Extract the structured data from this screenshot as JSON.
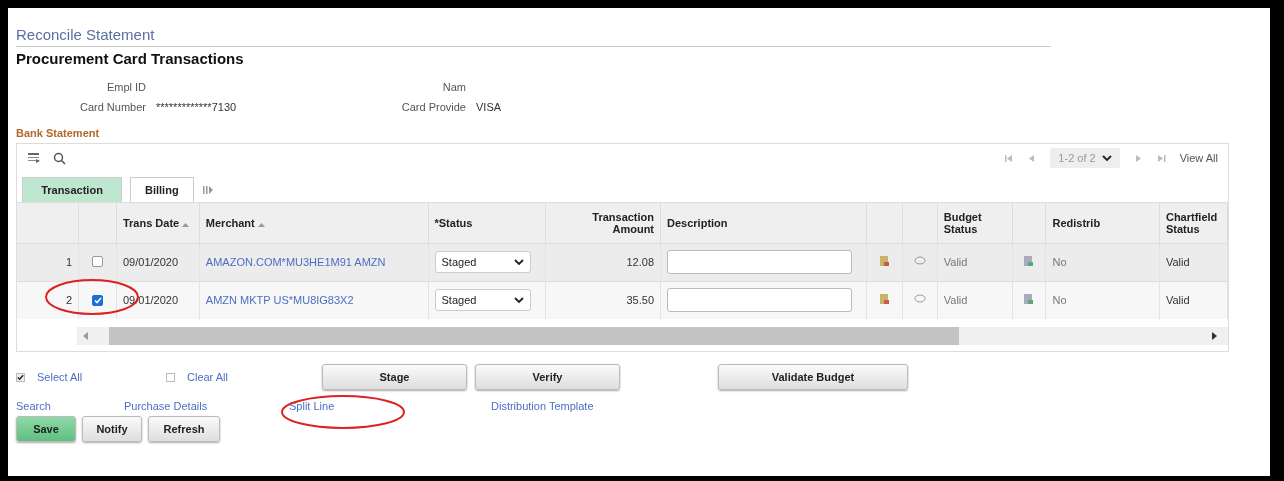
{
  "page_title": "Reconcile Statement",
  "heading": "Procurement Card Transactions",
  "fields": [
    {
      "label": "Empl ID"
    },
    {
      "label": "Nam"
    },
    {
      "label": "Card Number",
      "value": "*************7130"
    },
    {
      "label": "Card Provide",
      "value": "VISA"
    }
  ],
  "section_title": "Bank Statement",
  "pager": {
    "range": "1-2 of 2",
    "view_all": "View All"
  },
  "tabs": [
    {
      "label": "Transaction",
      "selected": true
    },
    {
      "label": "Billing",
      "selected": false
    }
  ],
  "columns": [
    "",
    "",
    "Trans Date",
    "Merchant",
    "*Status",
    "Transaction Amount",
    "Description",
    "",
    "",
    "Budget Status",
    "",
    "Redistrib",
    "Chartfield Status"
  ],
  "rows": [
    {
      "number": "1",
      "checked": false,
      "date": "09/01/2020",
      "merchant": "AMAZON.COM*MU3HE1M91 AMZN",
      "status": "Staged",
      "amount": "12.08",
      "budget_status": "Valid",
      "redistrib": "No",
      "chartfield_status": "Valid"
    },
    {
      "number": "2",
      "checked": true,
      "date": "09/01/2020",
      "merchant": "AMZN MKTP US*MU8IG83X2",
      "status": "Staged",
      "amount": "35.50",
      "budget_status": "Valid",
      "redistrib": "No",
      "chartfield_status": "Valid"
    }
  ],
  "select_links": [
    {
      "label": "Select All",
      "checked": true
    },
    {
      "label": "Clear All",
      "checked": false
    }
  ],
  "action_buttons": [
    "Stage",
    "Verify",
    "Validate Budget"
  ],
  "links": [
    "Search",
    "Purchase Details",
    "Split Line",
    "Distribution Template"
  ],
  "footer_buttons": [
    {
      "label": "Save",
      "kind": "primary"
    },
    {
      "label": "Notify",
      "kind": "plain"
    },
    {
      "label": "Refresh",
      "kind": "plain"
    }
  ]
}
